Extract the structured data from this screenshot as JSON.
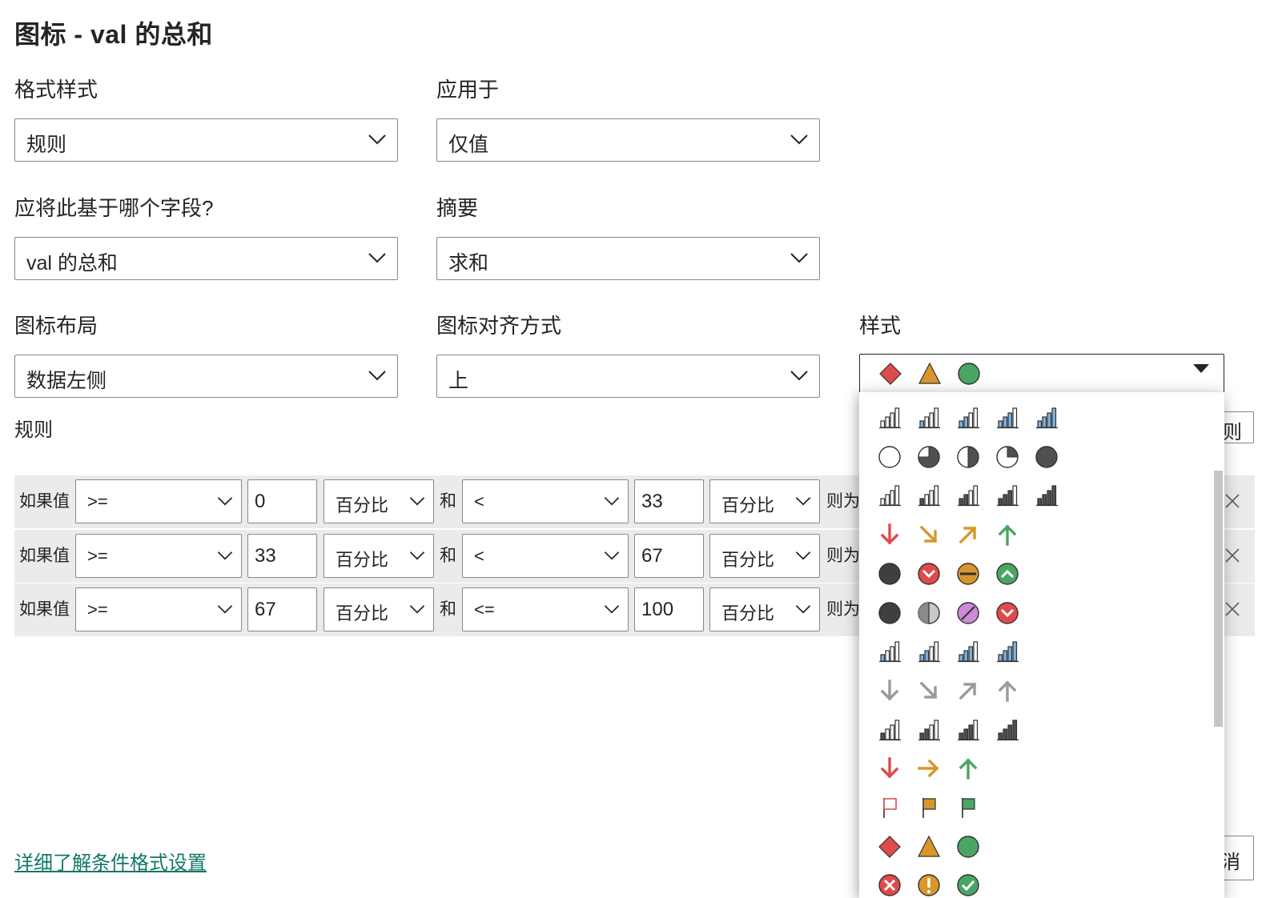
{
  "title": "图标 - val 的总和",
  "format_style": {
    "label": "格式样式",
    "value": "规则"
  },
  "apply_to": {
    "label": "应用于",
    "value": "仅值"
  },
  "based_on": {
    "label": "应将此基于哪个字段?",
    "value": "val 的总和"
  },
  "summary": {
    "label": "摘要",
    "value": "求和"
  },
  "icon_layout": {
    "label": "图标布局",
    "value": "数据左侧"
  },
  "icon_alignment": {
    "label": "图标对齐方式",
    "value": "上"
  },
  "style": {
    "label": "样式",
    "selected_icons": [
      "diamond-red-icon",
      "triangle-yellow-icon",
      "circle-green-icon"
    ],
    "icon_sets": [
      [
        "bars-0-icon",
        "bars-1-blue-icon",
        "bars-2-blue-icon",
        "bars-3-blue-icon",
        "bars-4-blue-icon"
      ],
      [
        "pie-empty-icon",
        "pie-quarter-icon",
        "pie-half-icon",
        "pie-three-quarter-icon",
        "pie-full-icon"
      ],
      [
        "bars-0-icon",
        "bars-1-dark-icon",
        "bars-2-dark-icon",
        "bars-3-dark-icon",
        "bars-4-dark-icon"
      ],
      [
        "arrow-down-red-icon",
        "arrow-downright-yellow-icon",
        "arrow-upright-yellow-icon",
        "arrow-up-green-icon"
      ],
      [
        "circle-black-icon",
        "circle-red-down-icon",
        "circle-yellow-dash-icon",
        "circle-green-up-icon"
      ],
      [
        "circle-black-icon",
        "circle-gray-half-icon",
        "circle-purple-slash-icon",
        "circle-red-down-icon"
      ],
      [
        "bars-1-blue-icon",
        "bars-2-blue-icon",
        "bars-3-blue-icon",
        "bars-4-blue-icon"
      ],
      [
        "arrow-down-gray-icon",
        "arrow-downright-gray-icon",
        "arrow-upright-gray-icon",
        "arrow-up-gray-icon"
      ],
      [
        "bars-1-dark-icon",
        "bars-2-dark-icon",
        "bars-3-dark-icon",
        "bars-4-dark-icon"
      ],
      [
        "arrow-down-red-icon",
        "arrow-right-yellow-icon",
        "arrow-up-green-icon"
      ],
      [
        "flag-red-icon",
        "flag-yellow-icon",
        "flag-green-icon"
      ],
      [
        "diamond-red-icon",
        "triangle-yellow-icon",
        "circle-green-icon"
      ],
      [
        "x-circle-red-icon",
        "exclamation-circle-yellow-icon",
        "check-circle-green-icon"
      ]
    ],
    "colors": {
      "red": "#e04a4a",
      "yellow": "#d9962b",
      "green": "#4aa564",
      "blue": "#7fb4e3",
      "dark": "#505050",
      "gray": "#9a9a9a",
      "purple": "#cc8ad8"
    }
  },
  "rules_label": "规则",
  "rules": [
    {
      "if_label": "如果值",
      "op1": ">=",
      "v1": "0",
      "unit1": "百分比",
      "and_label": "和",
      "op2": "<",
      "v2": "33",
      "unit2": "百分比",
      "then_label": "则为"
    },
    {
      "if_label": "如果值",
      "op1": ">=",
      "v1": "33",
      "unit1": "百分比",
      "and_label": "和",
      "op2": "<",
      "v2": "67",
      "unit2": "百分比",
      "then_label": "则为"
    },
    {
      "if_label": "如果值",
      "op1": ">=",
      "v1": "67",
      "unit1": "百分比",
      "and_label": "和",
      "op2": "<=",
      "v2": "100",
      "unit2": "百分比",
      "then_label": "则为"
    }
  ],
  "partial_button_top": "则",
  "partial_button_bottom": "消",
  "learn_more_link": "详细了解条件格式设置"
}
